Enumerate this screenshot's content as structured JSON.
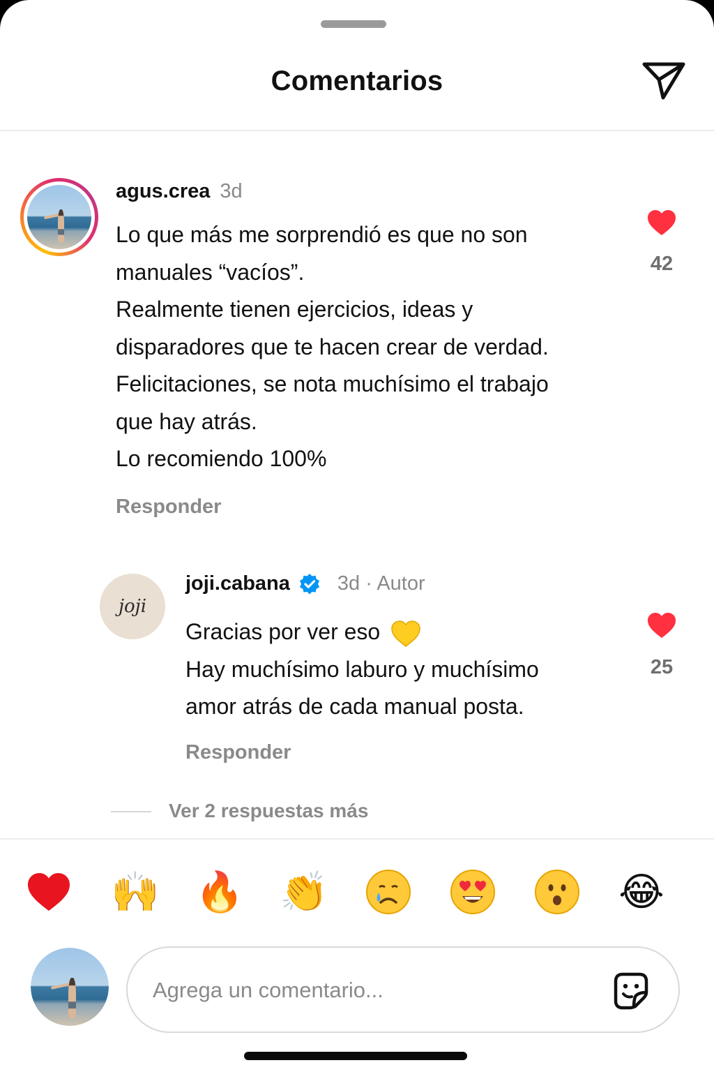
{
  "header": {
    "title": "Comentarios",
    "share_icon": "send-icon"
  },
  "comments": [
    {
      "username": "agus.crea",
      "time": "3d",
      "text": "Lo que más me sorprendió es que no son\nmanuales “vacíos”.\nRealmente tienen ejercicios, ideas y\ndisparadores que te hacen crear de verdad.\nFelicitaciones, se nota muchísimo el trabajo\nque hay atrás.\nLo recomiendo 100%",
      "likes": "42",
      "reply_label": "Responder",
      "has_story_ring": true
    }
  ],
  "reply": {
    "username": "joji.cabana",
    "verified": true,
    "time_author": "3d · Autor",
    "text_line1": "Gracias por ver eso",
    "text_rest": "Hay muchísimo laburo y muchísimo\namor atrás de cada manual posta.",
    "emoji": "yellow-heart-emoji",
    "likes": "25",
    "reply_label": "Responder",
    "avatar_text": "joji"
  },
  "more_replies": "Ver 2 respuestas más",
  "quick_reactions": [
    "❤️",
    "🙌",
    "🔥",
    "👏",
    "😢",
    "😍",
    "😮",
    "😂"
  ],
  "composer": {
    "placeholder": "Agrega un comentario...",
    "sticker_icon": "sticker-icon"
  },
  "colors": {
    "like_red": "#ff3040",
    "verified_blue": "#0095f6",
    "muted_text": "#8a8a8a"
  }
}
